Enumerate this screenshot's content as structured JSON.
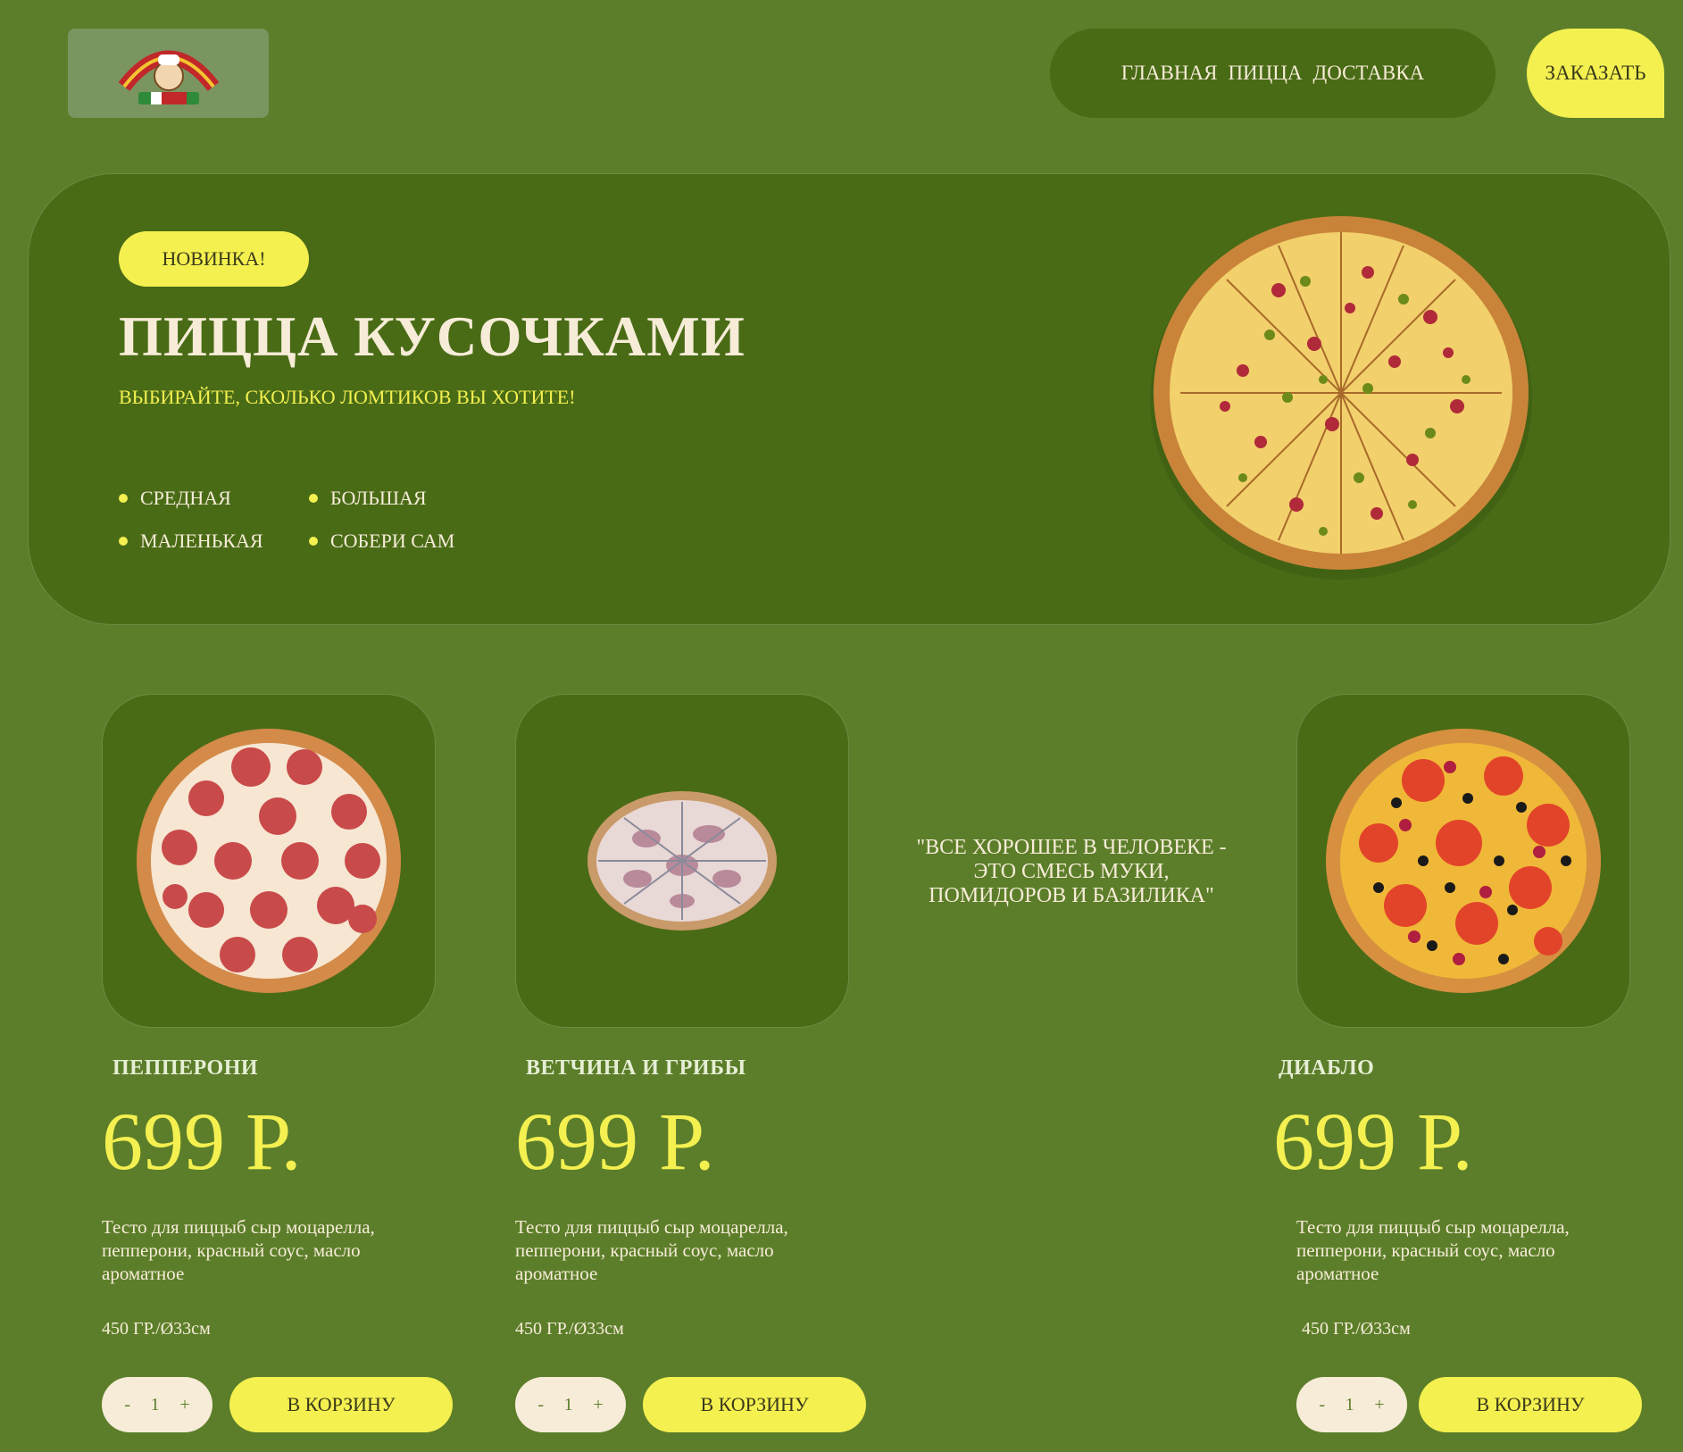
{
  "header": {
    "logo_alt": "Hot Town Pizza",
    "nav": [
      "ГЛАВНАЯ",
      "ПИЦЦА",
      "ДОСТАВКА"
    ],
    "order_label": "ЗАКАЗАТЬ"
  },
  "hero": {
    "badge": "НОВИНКА!",
    "title": "ПИЦЦА КУСОЧКАМИ",
    "subtitle": "ВЫБИРАЙТЕ, СКОЛЬКО ЛОМТИКОВ ВЫ ХОТИТЕ!",
    "sizes": [
      "СРЕДНАЯ",
      "БОЛЬШАЯ",
      "МАЛЕНЬКАЯ",
      "СОБЕРИ САМ"
    ]
  },
  "quote": "\"ВСЕ ХОРОШЕЕ В ЧЕЛОВЕКЕ - ЭТО СМЕСЬ МУКИ, ПОМИДОРОВ И БАЗИЛИКА\"",
  "products": [
    {
      "name": "ПЕППЕРОНИ",
      "price": "699 Р.",
      "description": "Тесто для пиццыб сыр моцарелла, пепперони, красный соус, масло ароматное",
      "weight": "450 ГР./Ø33см",
      "qty_minus": "-",
      "qty": "1",
      "qty_plus": "+",
      "cart_label": "В КОРЗИНУ"
    },
    {
      "name": "ВЕТЧИНА И ГРИБЫ",
      "price": "699 Р.",
      "description": "Тесто для пиццыб сыр моцарелла, пепперони, красный соус, масло ароматное",
      "weight": "450 ГР./Ø33см",
      "qty_minus": "-",
      "qty": "1",
      "qty_plus": "+",
      "cart_label": "В КОРЗИНУ"
    },
    {
      "name": "ДИАБЛО",
      "price": "699 Р.",
      "description": "Тесто для пиццыб сыр моцарелла, пепперони, красный соус, масло ароматное",
      "weight": "450 ГР./Ø33см",
      "qty_minus": "-",
      "qty": "1",
      "qty_plus": "+",
      "cart_label": "В КОРЗИНУ"
    }
  ],
  "colors": {
    "background": "#5c7e2a",
    "panel": "#496b16",
    "accent_yellow": "#f4f050",
    "cream": "#f7ecd8"
  }
}
